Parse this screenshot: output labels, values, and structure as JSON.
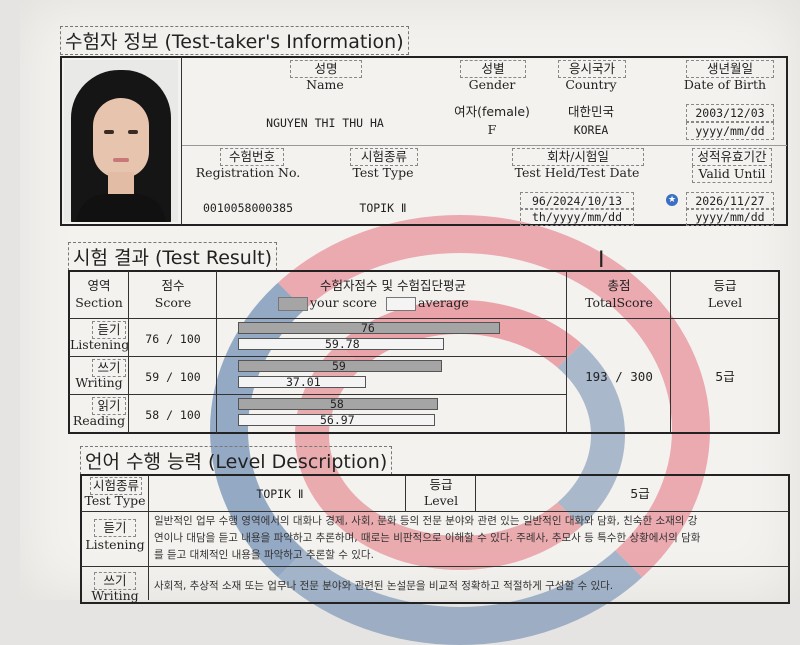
{
  "info": {
    "heading": "수험자 정보 (Test-taker's Information)",
    "name_ko": "성명",
    "name_en": "Name",
    "name_value": "NGUYEN THI THU HA",
    "gender_ko": "성별",
    "gender_en": "Gender",
    "gender_value_ko": "여자(female)",
    "gender_value_en": "F",
    "country_ko": "응시국가",
    "country_en": "Country",
    "country_value_ko": "대한민국",
    "country_value_en": "KOREA",
    "dob_ko": "생년월일",
    "dob_en": "Date of Birth",
    "dob_value": "2003/12/03",
    "dob_format": "yyyy/mm/dd",
    "reg_ko": "수험번호",
    "reg_en": "Registration No.",
    "reg_value": "0010058000385",
    "type_ko": "시험종류",
    "type_en": "Test Type",
    "type_value": "TOPIK Ⅱ",
    "held_ko": "회차/시험일",
    "held_en": "Test Held/Test Date",
    "held_value": "96/2024/10/13",
    "held_format": "th/yyyy/mm/dd",
    "valid_ko": "성적유효기간",
    "valid_en": "Valid Until",
    "valid_value": "2026/11/27",
    "valid_format": "yyyy/mm/dd"
  },
  "result": {
    "heading": "시험 결과 (Test Result)",
    "section_ko": "영역",
    "section_en": "Section",
    "score_ko": "점수",
    "score_en": "Score",
    "avg_ko": "수험자점수 및 수험집단평균",
    "your_score": "your score",
    "average": "average",
    "total_ko": "총점",
    "total_en": "TotalScore",
    "total_value": "193 / 300",
    "level_ko": "등급",
    "level_en": "Level",
    "level_value": "5급",
    "rows": [
      {
        "ko": "듣기",
        "en": "Listening",
        "score": "76 / 100",
        "your": 76,
        "avg": 59.78,
        "your_label": "76",
        "avg_label": "59.78"
      },
      {
        "ko": "쓰기",
        "en": "Writing",
        "score": "59 / 100",
        "your": 59,
        "avg": 37.01,
        "your_label": "59",
        "avg_label": "37.01"
      },
      {
        "ko": "읽기",
        "en": "Reading",
        "score": "58 / 100",
        "your": 58,
        "avg": 56.97,
        "your_label": "58",
        "avg_label": "56.97"
      }
    ]
  },
  "level_desc": {
    "heading": "언어 수행 능력 (Level Description)",
    "type_ko": "시험종류",
    "type_en": "Test Type",
    "type_value": "TOPIK Ⅱ",
    "level_ko": "등급",
    "level_en": "Level",
    "level_value": "5급",
    "listening_ko": "듣기",
    "listening_en": "Listening",
    "listening_text_1": "일반적인 업무 수행 영역에서의 대화나 경제, 사회, 문화 등의 전문 분야와 관련 있는 일반적인 대화와 담화, 친숙한 소재의 강",
    "listening_text_2": "연이나 대담을 듣고 내용을 파악하고 추론하며, 때로는 비판적으로 이해할 수 있다. 주례사, 추모사 등 특수한 상황에서의 담화",
    "listening_text_3": "를 듣고 대체적인 내용을 파악하고 추론할 수 있다.",
    "writing_ko": "쓰기",
    "writing_en": "Writing",
    "writing_text_1": "사회적, 추상적 소재 또는 업무나 전문 분야와 관련된 논설문을 비교적 정확하고 적절하게 구성할 수 있다."
  },
  "colors": {
    "bar_dark": "#a5a5a5",
    "bar_light": "#f4f4f4",
    "seal_red": "#e46e7c",
    "seal_blue": "#466ea0"
  }
}
